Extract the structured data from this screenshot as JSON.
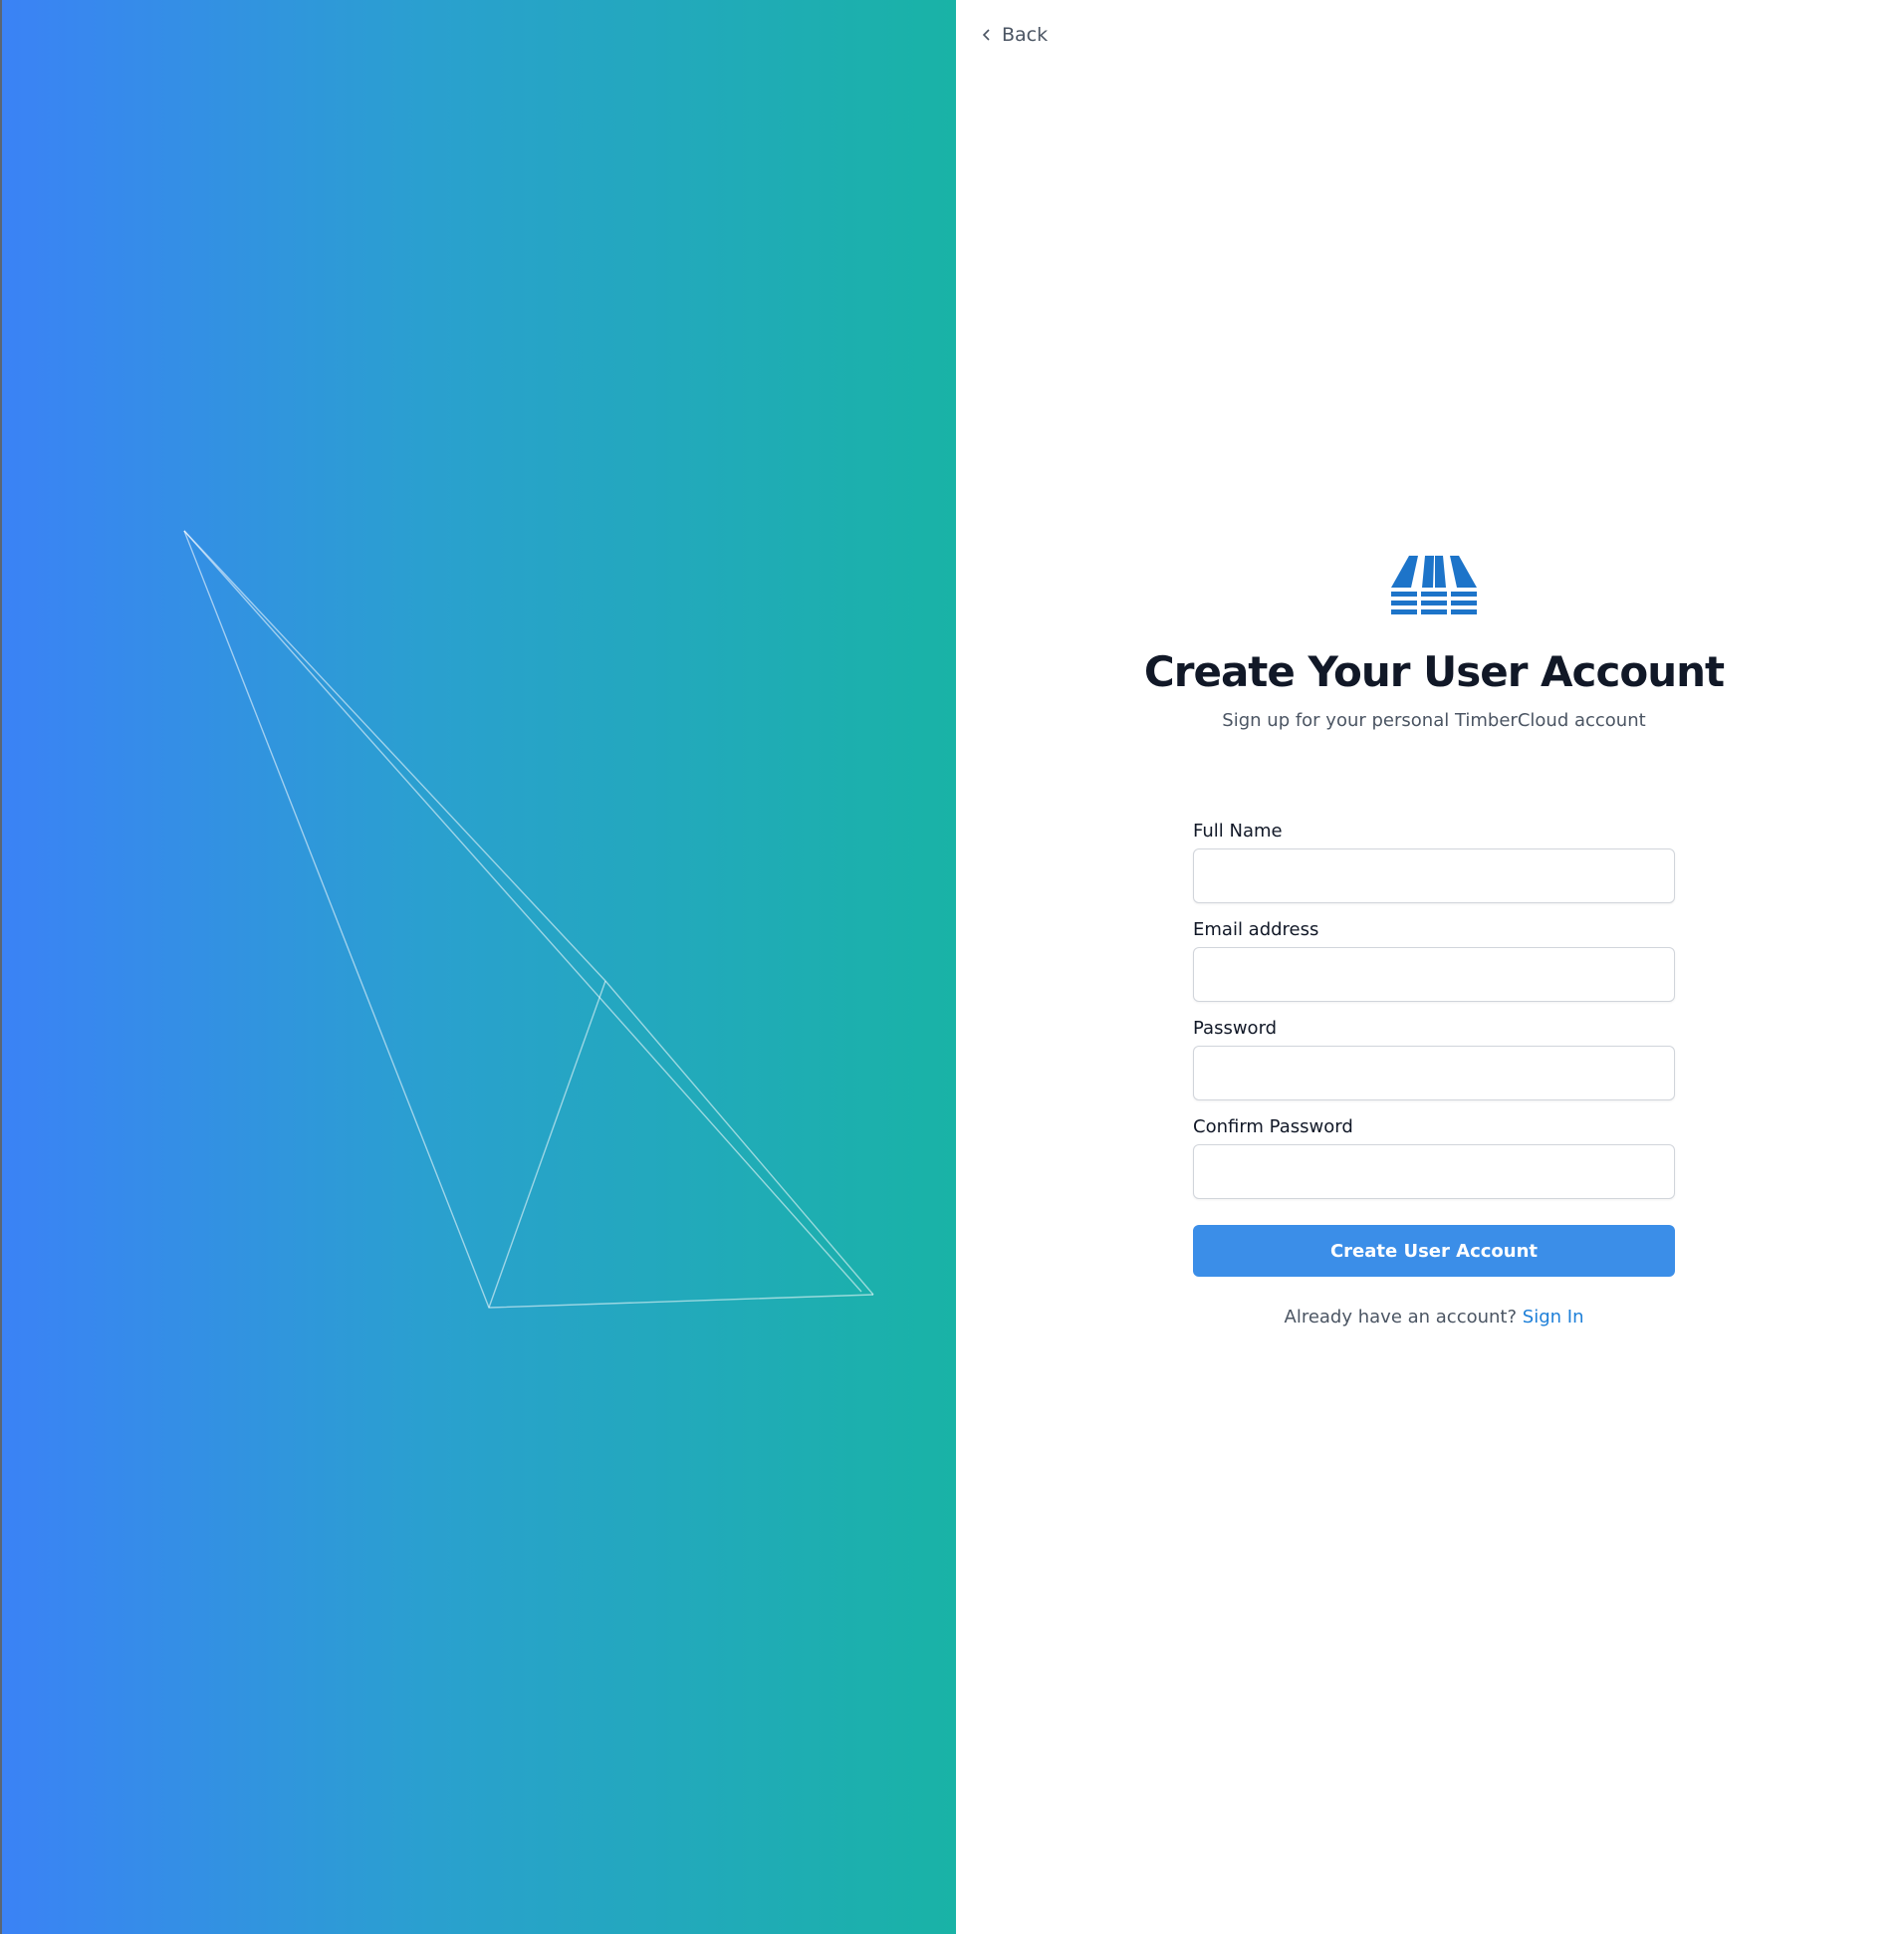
{
  "nav": {
    "back_label": "Back"
  },
  "header": {
    "title": "Create Your User Account",
    "subtitle": "Sign up for your personal TimberCloud account"
  },
  "form": {
    "fields": [
      {
        "label": "Full Name",
        "value": ""
      },
      {
        "label": "Email address",
        "value": ""
      },
      {
        "label": "Password",
        "value": ""
      },
      {
        "label": "Confirm Password",
        "value": ""
      }
    ],
    "submit_label": "Create User Account"
  },
  "footer": {
    "prompt": "Already have an account?",
    "signin_label": "Sign In"
  },
  "colors": {
    "gradient_start": "#3b82f6",
    "gradient_end": "#19b3a6",
    "primary_button": "#3b8ee8",
    "link": "#1d7fd8",
    "logo": "#1d74c9"
  },
  "icons": {
    "back": "chevron-left-icon",
    "logo": "timbercloud-logo-icon"
  }
}
